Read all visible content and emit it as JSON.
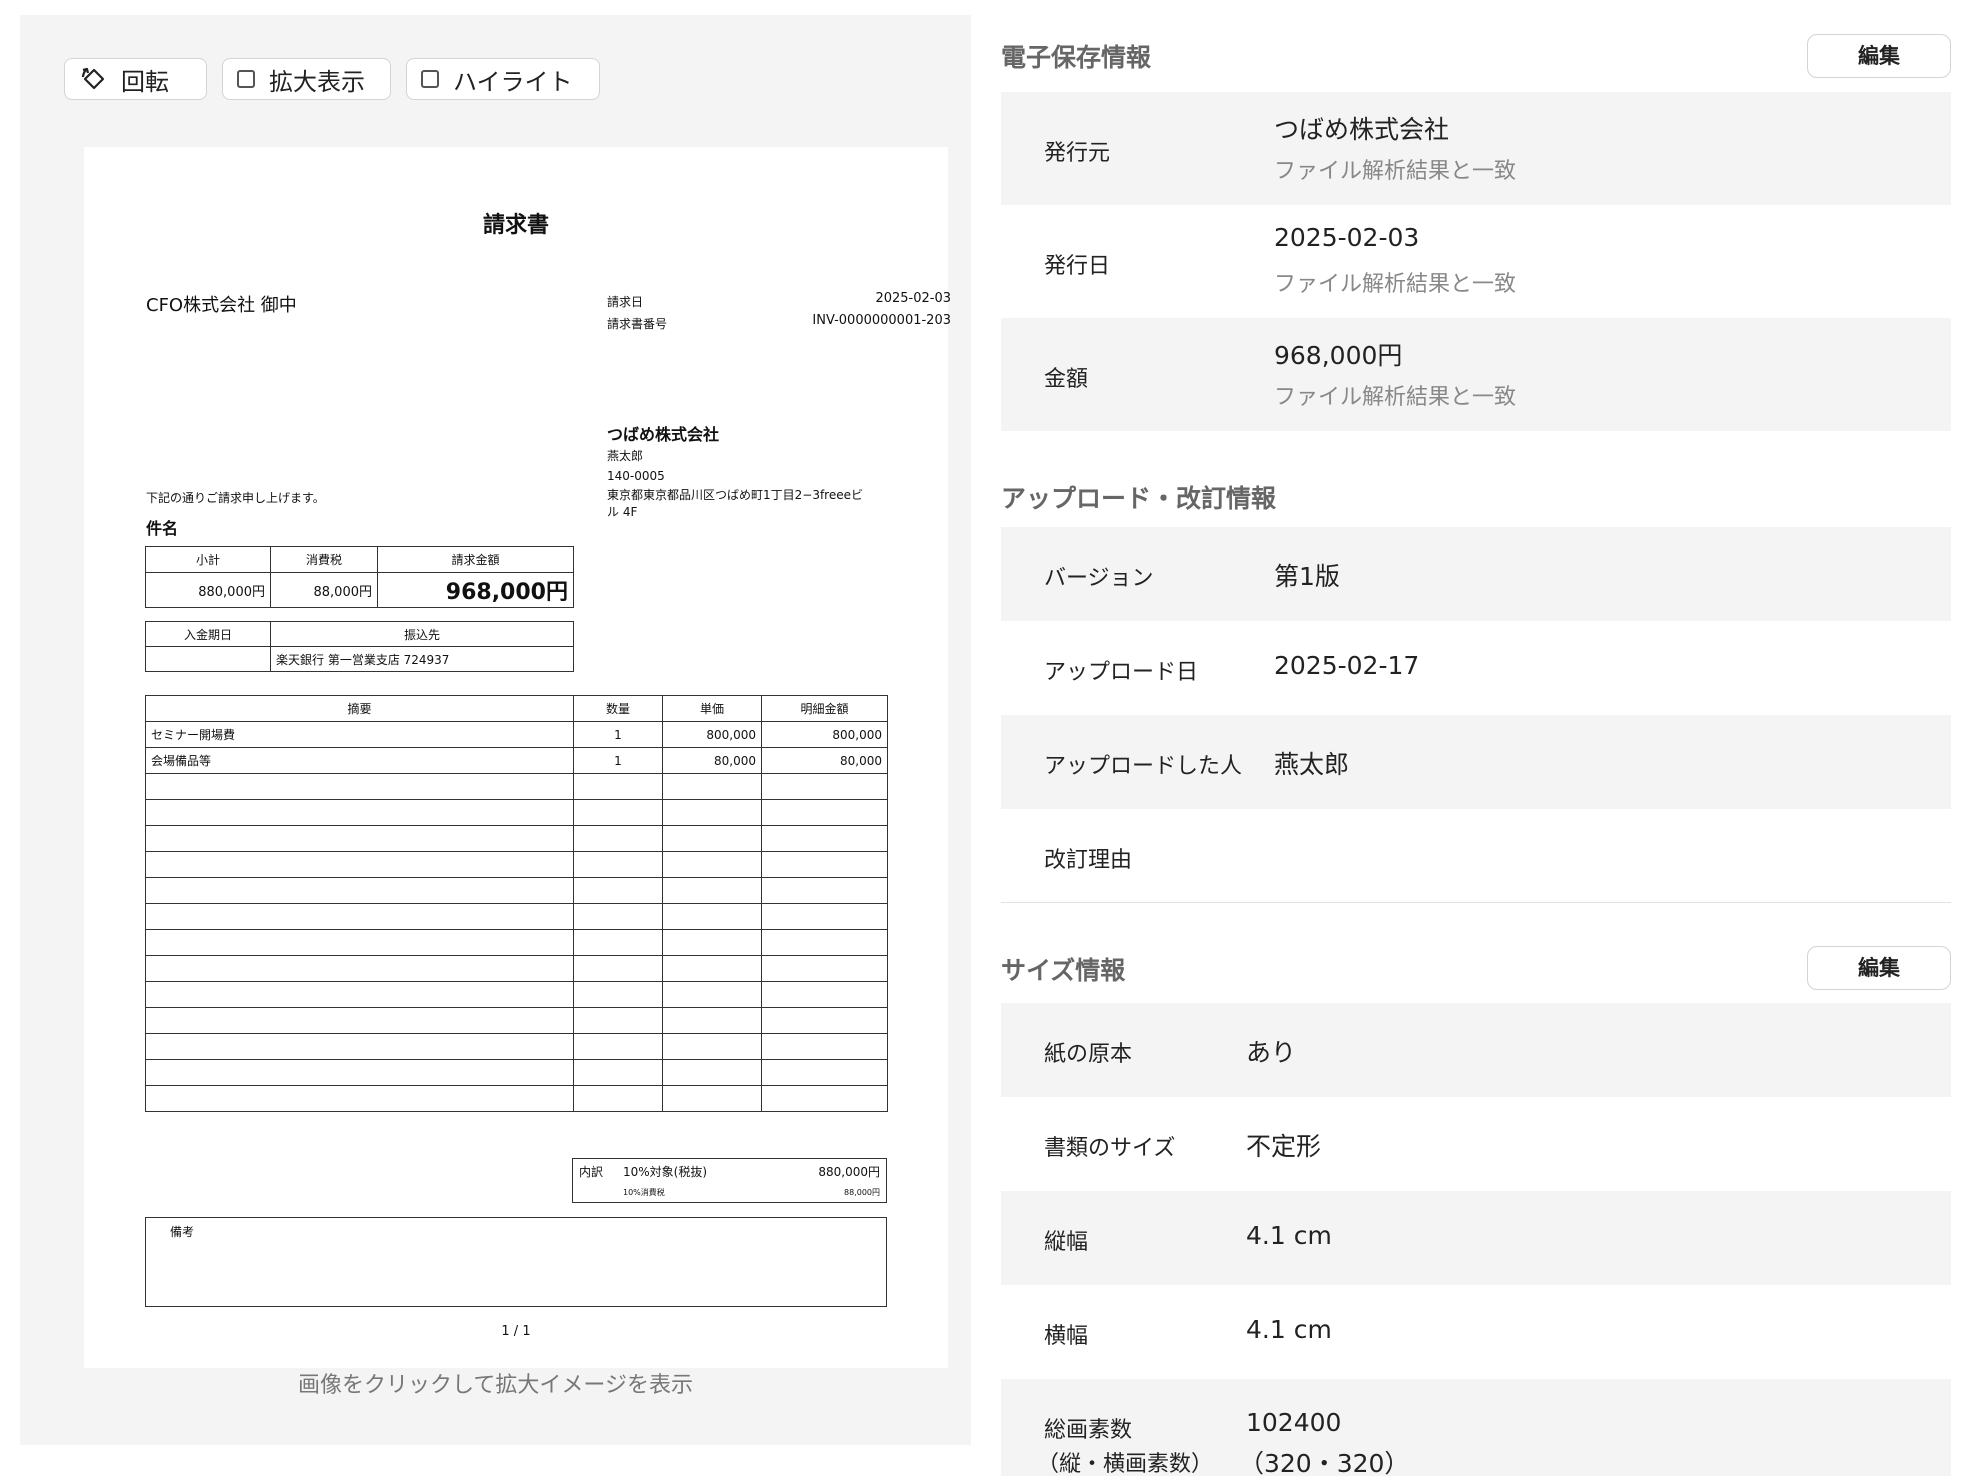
{
  "toolbar": {
    "rotate_label": "回転",
    "zoom_label": "拡大表示",
    "highlight_label": "ハイライト"
  },
  "viewer": {
    "click_hint": "画像をクリックして拡大イメージを表示"
  },
  "invoice": {
    "title": "請求書",
    "recipient": "CFO株式会社 御中",
    "meta": {
      "date_label": "請求日",
      "date_value": "2025-02-03",
      "number_label": "請求書番号",
      "number_value": "INV-0000000001-203"
    },
    "issuer": {
      "name": "つばめ株式会社",
      "person": "燕太郎",
      "postal": "140-0005",
      "address_line1": "東京都東京都品川区つばめ町1丁目2−3freeeビ",
      "address_line2": "ル 4F"
    },
    "intro": "下記の通りご請求申し上げます。",
    "subject_label": "件名",
    "summary": {
      "headers": [
        "小計",
        "消費税",
        "請求金額"
      ],
      "subtotal": "880,000円",
      "tax": "88,000円",
      "total": "968,000円"
    },
    "payment": {
      "headers": [
        "入金期日",
        "振込先"
      ],
      "due": "",
      "bank": "楽天銀行 第一営業支店 724937"
    },
    "items": {
      "headers": [
        "摘要",
        "数量",
        "単価",
        "明細金額"
      ],
      "rows": [
        [
          "セミナー開場費",
          "1",
          "800,000",
          "800,000"
        ],
        [
          "会場備品等",
          "1",
          "80,000",
          "80,000"
        ],
        [
          "",
          "",
          "",
          ""
        ],
        [
          "",
          "",
          "",
          ""
        ],
        [
          "",
          "",
          "",
          ""
        ],
        [
          "",
          "",
          "",
          ""
        ],
        [
          "",
          "",
          "",
          ""
        ],
        [
          "",
          "",
          "",
          ""
        ],
        [
          "",
          "",
          "",
          ""
        ],
        [
          "",
          "",
          "",
          ""
        ],
        [
          "",
          "",
          "",
          ""
        ],
        [
          "",
          "",
          "",
          ""
        ],
        [
          "",
          "",
          "",
          ""
        ],
        [
          "",
          "",
          "",
          ""
        ],
        [
          "",
          "",
          "",
          ""
        ]
      ]
    },
    "breakdown": {
      "label": "内訳",
      "rate": "10%対象(税抜)",
      "amount": "880,000円",
      "tax_label": "10%消費税",
      "tax_amount": "88,000円"
    },
    "remarks_label": "備考",
    "page": "1 / 1"
  },
  "storage": {
    "title": "電子保存情報",
    "edit_label": "編集",
    "rows": [
      {
        "label": "発行元",
        "value": "つばめ株式会社",
        "note": "ファイル解析結果と一致"
      },
      {
        "label": "発行日",
        "value": "2025-02-03",
        "note": "ファイル解析結果と一致"
      },
      {
        "label": "金額",
        "value": "968,000円",
        "note": "ファイル解析結果と一致"
      }
    ]
  },
  "upload": {
    "title": "アップロード・改訂情報",
    "rows": [
      {
        "label": "バージョン",
        "value": "第1版"
      },
      {
        "label": "アップロード日",
        "value": "2025-02-17"
      },
      {
        "label": "アップロードした人",
        "value": "燕太郎"
      },
      {
        "label": "改訂理由",
        "value": ""
      }
    ]
  },
  "size": {
    "title": "サイズ情報",
    "edit_label": "編集",
    "rows": [
      {
        "label": "紙の原本",
        "value": "あり"
      },
      {
        "label": "書類のサイズ",
        "value": "不定形"
      },
      {
        "label": "縦幅",
        "value": "4.1 cm"
      },
      {
        "label": "横幅",
        "value": "4.1 cm"
      }
    ],
    "pixels": {
      "label_line1": "総画素数",
      "label_line2": "（縦・横画素数）",
      "value_line1": "102400",
      "value_line2": "（320・320）"
    }
  }
}
